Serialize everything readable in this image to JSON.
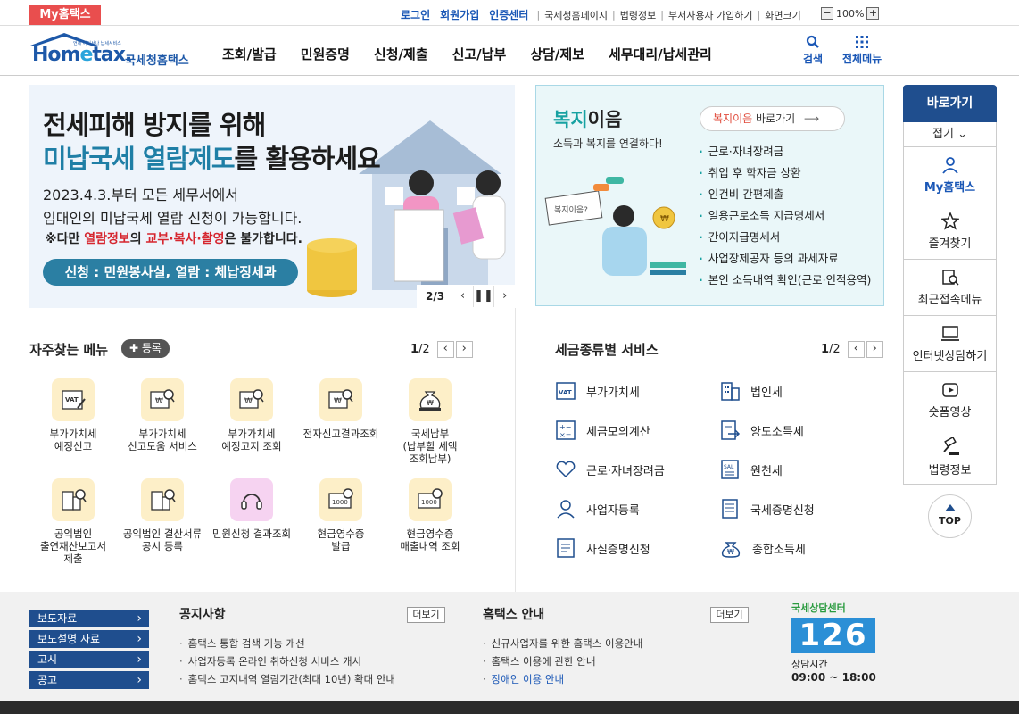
{
  "topbar": {
    "my_tab": "My홈택스",
    "login": "로그인",
    "join": "회원가입",
    "cert": "인증센터",
    "links": [
      "국세청홈페이지",
      "법령정보",
      "부서사용자 가입하기",
      "화면크기"
    ],
    "zoom": "100%"
  },
  "header": {
    "logo_text_home": "Hom",
    "logo_text_e": "e",
    "logo_text_tax": "tax.",
    "logo_tiny": "언제 어디서나 납세서비스",
    "logo_sub": "국세청홈택스",
    "nav": [
      "조회/발급",
      "민원증명",
      "신청/제출",
      "신고/납부",
      "상담/제보",
      "세무대리/납세관리"
    ],
    "search_label": "검색",
    "allmenu_label": "전체메뉴"
  },
  "banner": {
    "title_line1": "전세피해 방지를 위해",
    "title_hl": "미납국세 열람제도",
    "title_rest": "를 활용하세요",
    "body1": "2023.4.3.부터 모든 세무서에서",
    "body2": "임대인의 미납국세 열람 신청이 가능합니다.",
    "body3_pre": "※다만 ",
    "body3_red1": "열람정보",
    "body3_mid": "의 ",
    "body3_red2": "교부·복사·촬영",
    "body3_post": "은 불가합니다.",
    "pill": "신청 : 민원봉사실, 열람 : 체납징세과",
    "page": "2/3"
  },
  "welfare": {
    "title_g": "복지",
    "title_rest": "이음",
    "subtitle": "소득과 복지를 연결하다!",
    "btn_red": "복지이음",
    "btn_rest": " 바로가기",
    "items": [
      "근로·자녀장려금",
      "취업 후 학자금 상환",
      "인건비 간편제출",
      "일용근로소득 지급명세서",
      "간이지급명세서",
      "사업장제공자 등의 과세자료",
      "본인 소득내역 확인(근로·인적용역)"
    ]
  },
  "quick": {
    "title": "바로가기",
    "fold": "접기",
    "items": [
      "My홈택스",
      "즐겨찾기",
      "최근접속메뉴",
      "인터넷상담하기",
      "숏폼영상",
      "법령정보"
    ],
    "top": "TOP"
  },
  "frequent": {
    "title": "자주찾는 메뉴",
    "add": "등록",
    "page_cur": "1",
    "page_total": "/2",
    "items": [
      {
        "label": "부가가치세\n예정신고",
        "icon": "vat-doc-icon"
      },
      {
        "label": "부가가치세\n신고도움 서비스",
        "icon": "won-search-icon"
      },
      {
        "label": "부가가치세\n예정고지 조회",
        "icon": "won-search-icon"
      },
      {
        "label": "전자신고결과조회",
        "icon": "won-search-icon"
      },
      {
        "label": "국세납부\n(납부할 세액\n조회납부)",
        "icon": "money-bag-icon"
      },
      {
        "label": "공익법인\n출연재산보고서\n제출",
        "icon": "building-search-icon"
      },
      {
        "label": "공익법인 결산서류\n공시 등록",
        "icon": "building-search-icon"
      },
      {
        "label": "민원신청 결과조회",
        "icon": "headset-icon"
      },
      {
        "label": "현금영수증\n발급",
        "icon": "receipt-icon"
      },
      {
        "label": "현금영수증\n매출내역 조회",
        "icon": "receipt-icon"
      }
    ]
  },
  "taxservice": {
    "title": "세금종류별 서비스",
    "page_cur": "1",
    "page_total": "/2",
    "left": [
      "부가가치세",
      "세금모의계산",
      "근로·자녀장려금",
      "사업자등록",
      "사실증명신청"
    ],
    "right": [
      "법인세",
      "양도소득세",
      "원천세",
      "국세증명신청",
      "종합소득세"
    ]
  },
  "footer": {
    "buttons": [
      "보도자료",
      "보도설명 자료",
      "고시",
      "공고"
    ],
    "notice_title": "공지사항",
    "more": "더보기",
    "notices": [
      "홈택스 통합 검색 기능 개선",
      "사업자등록 온라인 취하신청 서비스 개시",
      "홈택스 고지내역 열람기간(최대 10년) 확대 안내"
    ],
    "guide_title": "홈택스 안내",
    "guides": [
      "신규사업자를 위한 홈택스 이용안내",
      "홈택스 이용에 관한 안내",
      "장애인 이용 안내"
    ],
    "center_title": "국세상담센터",
    "center_num": "126",
    "center_hours_label": "상담시간",
    "center_hours": "09:00 ~ 18:00"
  },
  "colors": {
    "primary": "#1f4e8e",
    "accent_red": "#e94e4e",
    "teal": "#18a2a2",
    "link_blue": "#1a57b6"
  }
}
